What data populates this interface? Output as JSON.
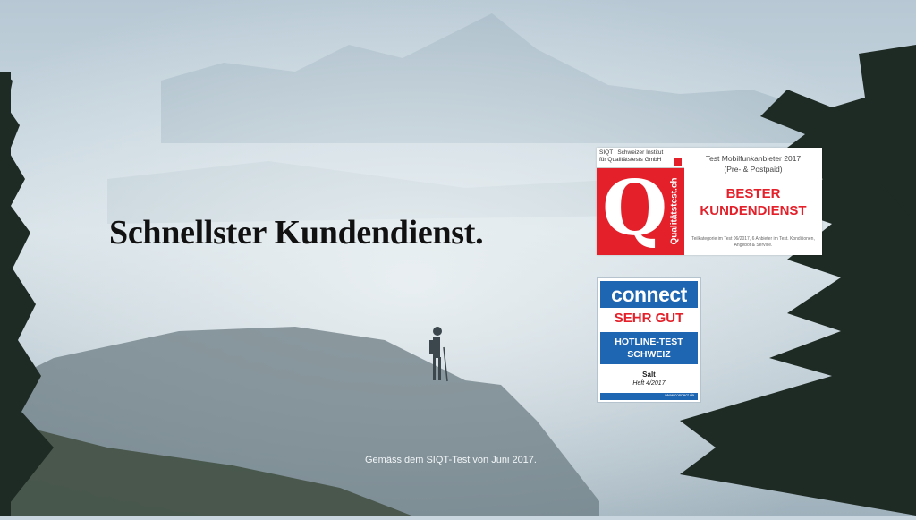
{
  "headline": "Schnellster Kundendienst.",
  "footnote": "Gemäss dem SIQT-Test von Juni 2017.",
  "siqt_badge": {
    "institute": "SIQT | Schweizer Institut für Qualitätstests GmbH",
    "logo_letter": "Q",
    "vertical_text": "Qualitätstest.ch",
    "test_name": "Test Mobilfunkanbieter 2017",
    "test_scope": "(Pre- & Postpaid)",
    "award_line1": "BESTER",
    "award_line2": "KUNDENDIENST",
    "fine_print": "Teilkategorie im Test 06/2017, 6 Anbieter im Test. Konditionen, Angebot & Service."
  },
  "connect_badge": {
    "logo": "connect",
    "grade": "SEHR GUT",
    "test_line1": "HOTLINE-TEST",
    "test_line2": "SCHWEIZ",
    "brand": "Salt",
    "issue": "Heft 4/2017",
    "url": "www.connect.de"
  },
  "colors": {
    "badge_red": "#e4202a",
    "badge_blue": "#1f66b2",
    "headline": "#111111"
  }
}
